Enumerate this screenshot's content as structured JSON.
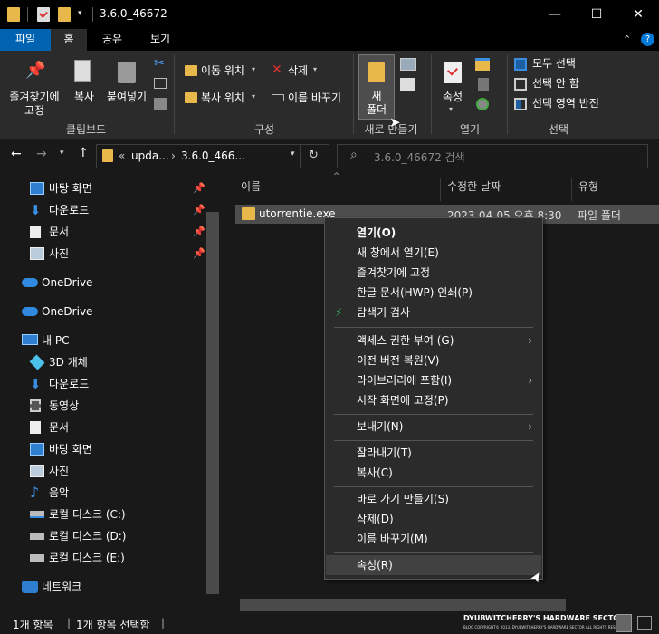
{
  "window": {
    "title": "3.6.0_46672"
  },
  "titlebar": {
    "minimize": "—",
    "maximize": "☐",
    "close": "✕"
  },
  "tabs": [
    {
      "label": "파일"
    },
    {
      "label": "홈"
    },
    {
      "label": "공유"
    },
    {
      "label": "보기"
    }
  ],
  "ribbon": {
    "pin_label": "즐겨찾기에\n고정",
    "copy_label": "복사",
    "paste_label": "붙여넣기",
    "clipboard_group": "클립보드",
    "move_to": "이동 위치",
    "copy_to": "복사 위치",
    "delete": "삭제",
    "rename": "이름 바꾸기",
    "organize_group": "구성",
    "new_folder": "새\n폴더",
    "new_group": "새로 만들기",
    "properties": "속성",
    "open_group": "열기",
    "select_all": "모두 선택",
    "select_none": "선택 안 함",
    "invert_selection": "선택 영역 반전",
    "select_group": "선택"
  },
  "address": {
    "prefix": "«",
    "crumb1": "upda...",
    "crumb2": "3.6.0_466...",
    "search_placeholder": "3.6.0_46672 검색"
  },
  "nav": {
    "quick": [
      {
        "label": "바탕 화면"
      },
      {
        "label": "다운로드"
      },
      {
        "label": "문서"
      },
      {
        "label": "사진"
      }
    ],
    "onedrive1": "OneDrive",
    "onedrive2": "OneDrive",
    "pc": "내 PC",
    "pc_items": [
      {
        "label": "3D 개체"
      },
      {
        "label": "다운로드"
      },
      {
        "label": "동영상"
      },
      {
        "label": "문서"
      },
      {
        "label": "바탕 화면"
      },
      {
        "label": "사진"
      },
      {
        "label": "음악"
      },
      {
        "label": "로컬 디스크 (C:)"
      },
      {
        "label": "로컬 디스크 (D:)"
      },
      {
        "label": "로컬 디스크 (E:)"
      }
    ],
    "network": "네트워크"
  },
  "columns": {
    "name": "이름",
    "date": "수정한 날짜",
    "type": "유형"
  },
  "file": {
    "name": "utorrentie.exe",
    "date": "2023-04-05 오후 8:30",
    "type": "파일 폴더"
  },
  "menu": [
    {
      "label": "열기(O)",
      "bold": true
    },
    {
      "label": "새 창에서 열기(E)"
    },
    {
      "label": "즐겨찾기에 고정"
    },
    {
      "label": "한글 문서(HWP) 인쇄(P)"
    },
    {
      "label": "탐색기 검사"
    },
    {
      "label": "액세스 권한 부여 (G)"
    },
    {
      "label": "이전 버전 복원(V)"
    },
    {
      "label": "라이브러리에 포함(I)"
    },
    {
      "label": "시작 화면에 고정(P)"
    },
    {
      "label": "보내기(N)"
    },
    {
      "label": "잘라내기(T)"
    },
    {
      "label": "복사(C)"
    },
    {
      "label": "바로 가기 만들기(S)"
    },
    {
      "label": "삭제(D)"
    },
    {
      "label": "이름 바꾸기(M)"
    },
    {
      "label": "속성(R)"
    }
  ],
  "status": {
    "count": "1개 항목",
    "selected": "1개 항목 선택함"
  },
  "watermark": {
    "title": "DYUBWITCHERRY'S HARDWARE SECTOR",
    "sub": "BLOG COPYRIGHT© 2013. DYUBWITCHERRY'S HARDWARE SECTOR ALL RIGHTS RESERVED."
  },
  "colors": {
    "accent": "#0078d7",
    "bg": "#191919",
    "ribbon": "#2b2b2b",
    "folder": "#e8b84a"
  }
}
